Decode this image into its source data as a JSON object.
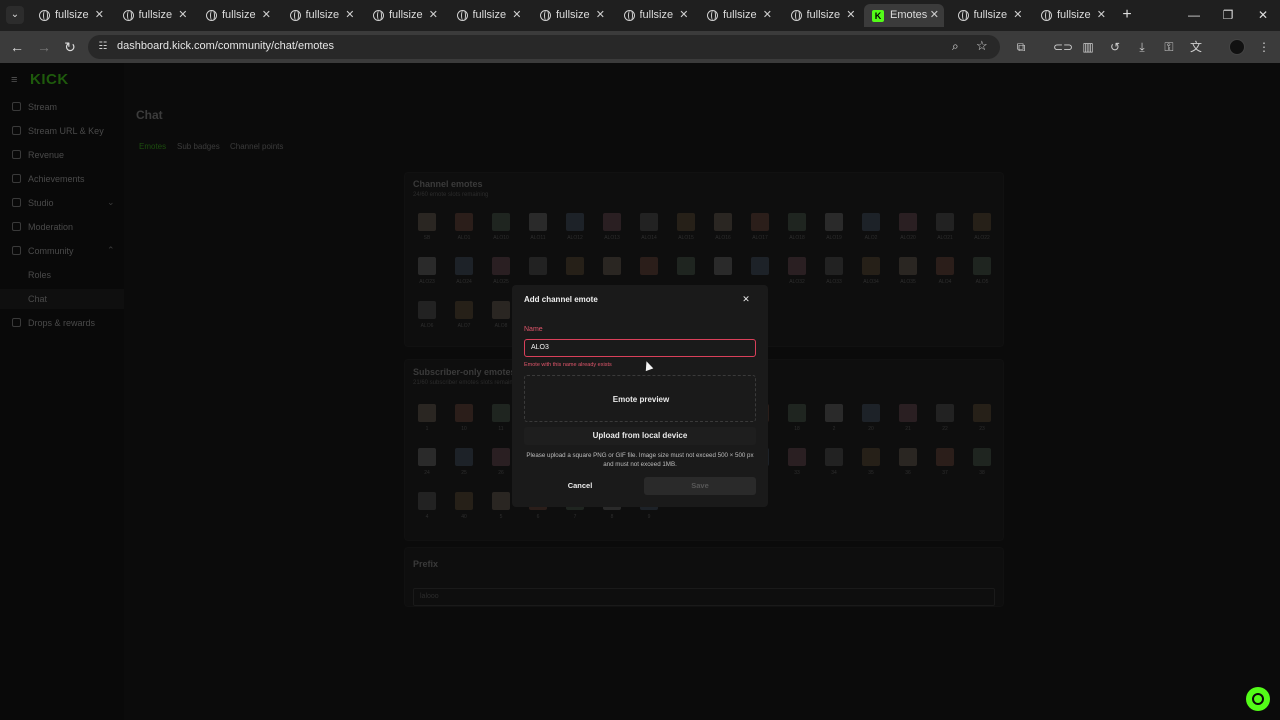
{
  "browser": {
    "tabs": [
      {
        "label": "fullsize",
        "active": false
      },
      {
        "label": "fullsize",
        "active": false
      },
      {
        "label": "fullsize",
        "active": false
      },
      {
        "label": "fullsize",
        "active": false
      },
      {
        "label": "fullsize",
        "active": false
      },
      {
        "label": "fullsize",
        "active": false
      },
      {
        "label": "fullsize",
        "active": false
      },
      {
        "label": "fullsize",
        "active": false
      },
      {
        "label": "fullsize",
        "active": false
      },
      {
        "label": "fullsize",
        "active": false
      },
      {
        "label": "Emotes",
        "active": true
      },
      {
        "label": "fullsize",
        "active": false
      },
      {
        "label": "fullsize",
        "active": false
      }
    ],
    "url": "dashboard.kick.com/community/chat/emotes",
    "tab_close_glyph": "✕",
    "new_tab_glyph": "+",
    "kick_favicon_letter": "K"
  },
  "sidebar": {
    "logo": "KICK",
    "items": [
      {
        "label": "Stream",
        "icon": "stream-icon"
      },
      {
        "label": "Stream URL & Key",
        "icon": "key-icon"
      },
      {
        "label": "Revenue",
        "icon": "revenue-icon"
      },
      {
        "label": "Achievements",
        "icon": "trophy-icon"
      },
      {
        "label": "Studio",
        "icon": "studio-icon",
        "chevron": "⌄"
      },
      {
        "label": "Moderation",
        "icon": "shield-icon"
      },
      {
        "label": "Community",
        "icon": "community-icon",
        "chevron": "⌃"
      },
      {
        "label": "Roles"
      },
      {
        "label": "Chat",
        "active": true
      },
      {
        "label": "Drops & rewards",
        "icon": "gift-icon"
      }
    ]
  },
  "content": {
    "title": "Chat",
    "tabs": [
      "Emotes",
      "Sub badges",
      "Channel points"
    ],
    "channel_emotes": {
      "title": "Channel emotes",
      "subtitle": "24/60 emote slots remaining",
      "row1": [
        "SB",
        "ALO1",
        "ALO10",
        "ALO11",
        "ALO12",
        "ALO13",
        "ALO14",
        "ALO15",
        "ALO16",
        "ALO17",
        "ALO18",
        "ALO19",
        "ALO2",
        "ALO20",
        "ALO21",
        "ALO22"
      ],
      "row2": [
        "ALO23",
        "ALO24",
        "ALO25",
        "",
        "",
        "",
        "",
        "",
        "",
        "",
        "ALO32",
        "ALO33",
        "ALO34",
        "ALO35",
        "ALO4",
        "ALO5"
      ],
      "row3": [
        "ALO6",
        "ALO7",
        "ALO8"
      ]
    },
    "subscriber_emotes": {
      "title": "Subscriber-only emotes",
      "subtitle": "21/60 subscriber emotes slots remaining",
      "row1": [
        "1",
        "10",
        "11",
        "",
        "",
        "",
        "",
        "",
        "",
        "",
        "18",
        "2",
        "20",
        "21",
        "22",
        "23"
      ],
      "row2": [
        "24",
        "25",
        "26",
        "",
        "",
        "",
        "",
        "",
        "",
        "",
        "33",
        "34",
        "35",
        "36",
        "37",
        "38"
      ],
      "row3": [
        "4",
        "40",
        "5",
        "6",
        "7",
        "8",
        "9"
      ]
    },
    "prefix": {
      "title": "Prefix",
      "value": "lalooo"
    }
  },
  "modal": {
    "title": "Add channel emote",
    "close_glyph": "✕",
    "name_label": "Name",
    "name_value": "ALO3",
    "error": "Emote with this name already exists",
    "preview_label": "Emote preview",
    "upload_label": "Upload from local device",
    "help_text": "Please upload a square PNG or GIF file. Image size must not exceed 500 × 500 px and must not exceed 1MB.",
    "cancel_label": "Cancel",
    "save_label": "Save"
  },
  "colors": {
    "kick_green": "#53fc18",
    "error_red": "#e0566b",
    "modal_bg": "#1a1a1a"
  }
}
